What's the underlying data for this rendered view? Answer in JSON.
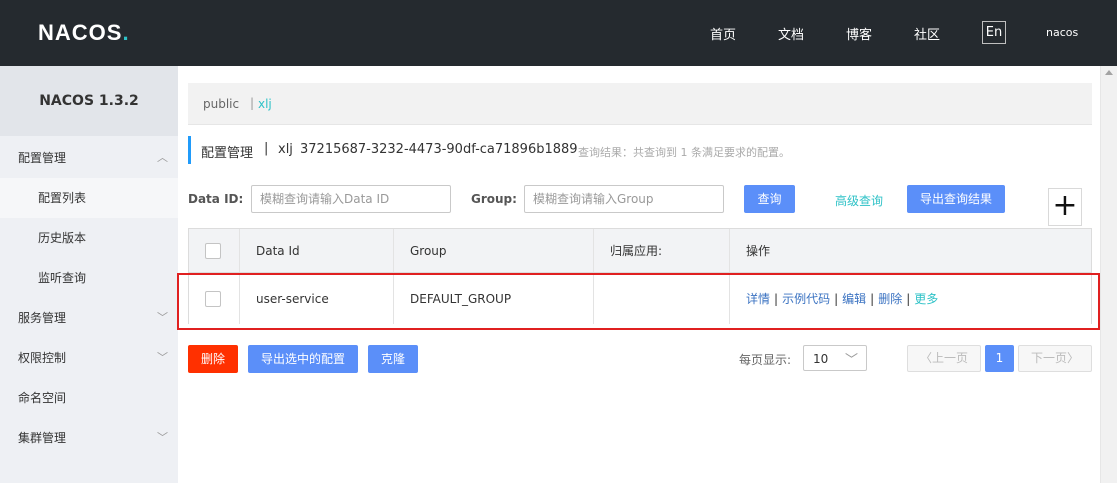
{
  "header": {
    "logo": "NACOS",
    "logo_dot": ".",
    "nav": [
      "首页",
      "文档",
      "博客",
      "社区"
    ],
    "lang": "En",
    "user": "nacos"
  },
  "sidebar": {
    "version": "NACOS 1.3.2",
    "items": [
      {
        "label": "配置管理",
        "expanded": true
      },
      {
        "label": "配置列表",
        "sub": true,
        "active": true
      },
      {
        "label": "历史版本",
        "sub": true
      },
      {
        "label": "监听查询",
        "sub": true
      },
      {
        "label": "服务管理",
        "expanded": false
      },
      {
        "label": "权限控制",
        "expanded": false
      },
      {
        "label": "命名空间"
      },
      {
        "label": "集群管理",
        "expanded": false
      }
    ]
  },
  "namespaces": {
    "public": "public",
    "separator": "|",
    "current": "xlj"
  },
  "title": {
    "text": "配置管理",
    "separator": "|",
    "namespace": "xlj",
    "namespace_id": "37215687-3232-4473-90df-ca71896b1889",
    "hint": "查询结果：共查询到 1 条满足要求的配置。"
  },
  "search": {
    "data_id_label": "Data ID:",
    "data_id_placeholder": "模糊查询请输入Data ID",
    "group_label": "Group:",
    "group_placeholder": "模糊查询请输入Group",
    "query_button": "查询",
    "advanced_link": "高级查询",
    "export_button": "导出查询结果",
    "add_symbol": "+"
  },
  "table": {
    "columns": [
      "Data Id",
      "Group",
      "归属应用:",
      "操作"
    ],
    "rows": [
      {
        "data_id": "user-service",
        "group": "DEFAULT_GROUP",
        "app": "",
        "actions": [
          "详情",
          "示例代码",
          "编辑",
          "删除",
          "更多"
        ]
      }
    ]
  },
  "actions": {
    "delete": "删除",
    "export_selected": "导出选中的配置",
    "clone": "克隆"
  },
  "pagination": {
    "page_size_label": "每页显示:",
    "page_size": "10",
    "prev": "上一页",
    "current_page": "1",
    "next": "下一页"
  },
  "colors": {
    "topbar": "#252a2f",
    "accent_teal": "#2ec2c7",
    "primary_blue": "#5b8ff9",
    "danger_red": "#ff3000",
    "highlight_border": "#e02020"
  }
}
